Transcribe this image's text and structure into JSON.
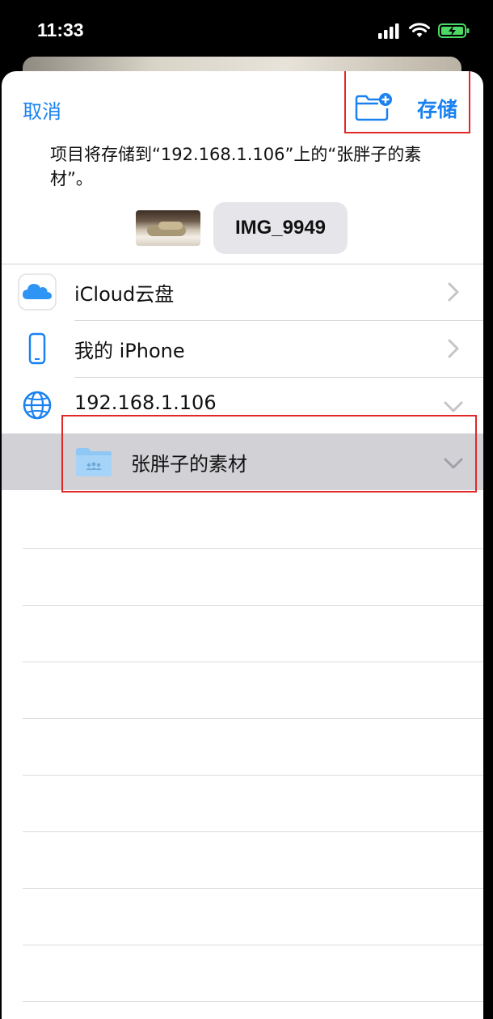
{
  "status_bar": {
    "time": "11:33",
    "icons": [
      "signal-icon",
      "wifi-icon",
      "battery-charging-icon"
    ]
  },
  "nav": {
    "cancel_label": "取消",
    "save_label": "存储",
    "new_folder_icon": "folder-plus-icon"
  },
  "description": "项目将存储到“192.168.1.106”上的“张胖子的素材”。",
  "file": {
    "name": "IMG_9949"
  },
  "locations": [
    {
      "label": "iCloud云盘",
      "icon": "icloud-icon"
    },
    {
      "label": "我的 iPhone",
      "icon": "iphone-icon"
    },
    {
      "label": "192.168.1.106",
      "icon": "globe-icon"
    }
  ],
  "selected_folder": {
    "label": "张胖子的素材",
    "icon": "shared-folder-icon"
  },
  "colors": {
    "accent": "#1a82f0",
    "highlight": "#d1d1d6",
    "annotation": "#e0282a"
  }
}
